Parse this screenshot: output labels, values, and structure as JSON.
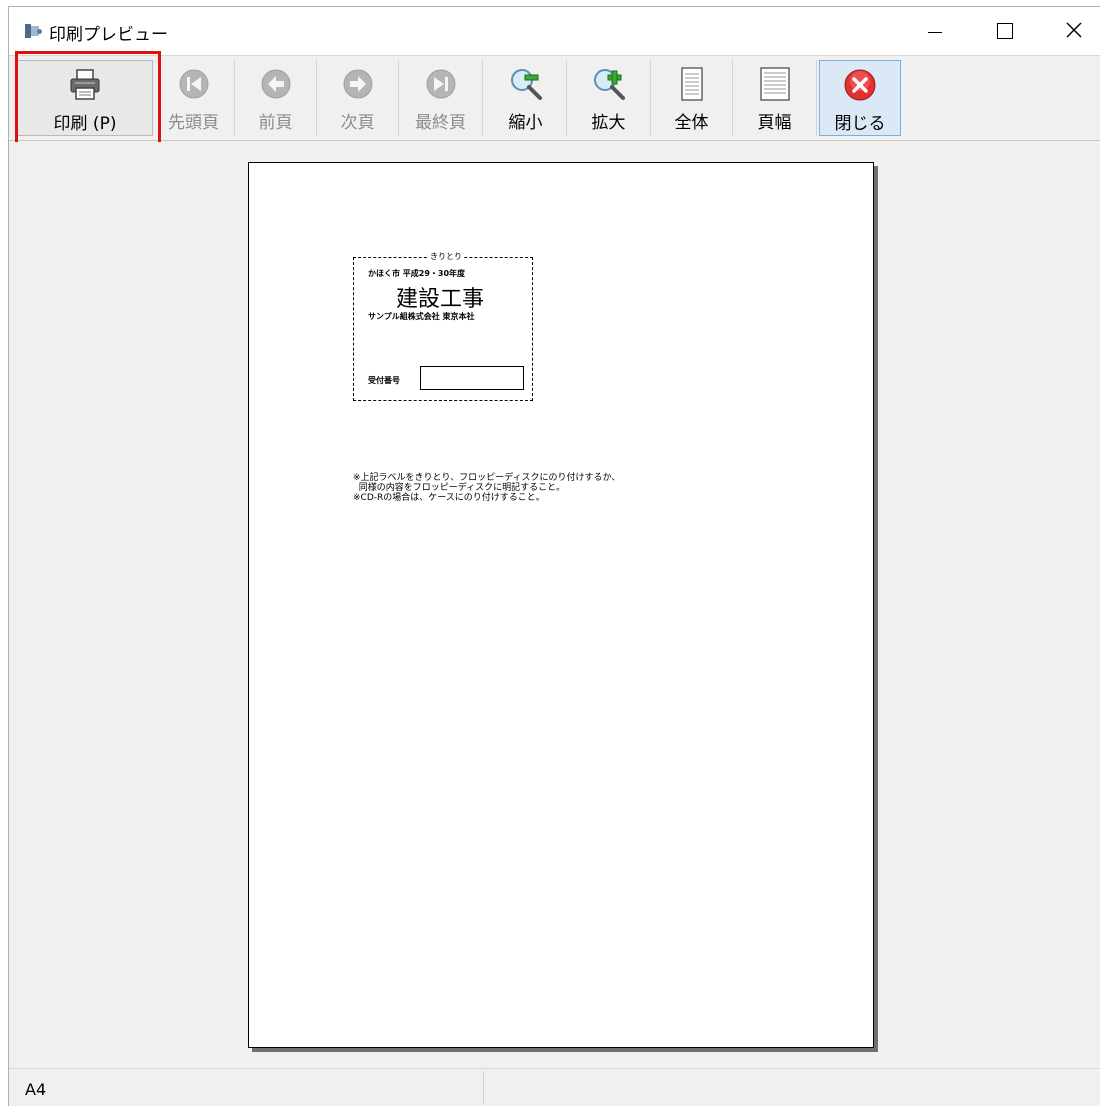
{
  "window": {
    "title": "印刷プレビュー"
  },
  "toolbar": {
    "print": "印刷 (P)",
    "first_page": "先頭頁",
    "prev_page": "前頁",
    "next_page": "次頁",
    "last_page": "最終頁",
    "zoom_out": "縮小",
    "zoom_in": "拡大",
    "whole_page": "全体",
    "page_width": "頁幅",
    "close": "閉じる"
  },
  "page": {
    "label": {
      "small_top": "きりとり",
      "line1": "かほく市 平成29・30年度",
      "title": "建設工事",
      "company": "サンプル組株式会社 東京本社",
      "receipt_label": "受付番号"
    },
    "notes": "※上記ラベルをきりとり、フロッピーディスクにのり付けするか、\n  同様の内容をフロッピーディスクに明記すること。\n※CD-Rの場合は、ケースにのり付けすること。"
  },
  "status": {
    "paper": "A4"
  },
  "colors": {
    "highlight": "#e01010",
    "close_icon": "#e23030"
  }
}
